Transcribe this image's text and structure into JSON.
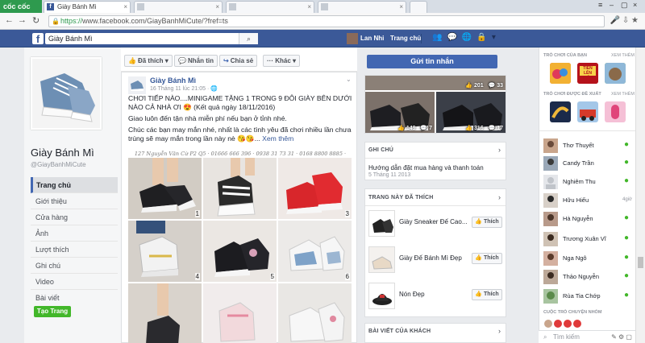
{
  "browser": {
    "brand": "cốc cốc",
    "tabs": [
      {
        "label": "Giày Bánh Mì"
      }
    ],
    "url_prefix": "https://",
    "url_rest": "www.facebook.com/GiayBanhMiCute/?fref=ts"
  },
  "fb": {
    "logo": "f",
    "search_value": "Giày Bánh Mì",
    "user": "Lan Nhi",
    "home": "Trang chủ",
    "brand_color": "#3b5998"
  },
  "page": {
    "name": "Giày Bánh Mì",
    "handle": "@GiayBanhMiCute",
    "nav": [
      "Trang chủ",
      "Giới thiệu",
      "Cửa hàng",
      "Ảnh",
      "Lượt thích",
      "Ghi chú",
      "Video",
      "Bài viết"
    ],
    "create_page": "Tạo Trang"
  },
  "actions": {
    "liked": "Đã thích",
    "message": "Nhắn tin",
    "share": "Chia sẻ",
    "more": "Khác",
    "send_message": "Gửi tin nhắn"
  },
  "post": {
    "author": "Giày Bánh Mì",
    "time": "16 Tháng 11 lúc 21:05 · ",
    "line1": "CHƠI TIẾP NÀO....MINIGAME TẶNG 1 TRONG 9 ĐÔI GIÀY BÊN DƯỚI NÀO CẢ NHÀ ƠI 😍 (Kết quả ngày 18/11/2016)",
    "line2": "Giao luôn đến tận nhà miễn phí nếu bạn ở tỉnh nhé.",
    "line3": "Chúc các bạn may mắn nhé, nhất là các tình yêu đã chơi nhiều lần chưa trúng sẽ may mắn trong lần này nè 😘😘...",
    "see_more": "Xem thêm",
    "banner": "127 Nguyễn Văn Cừ P2 Q5 · 01666 666 396 · 0938 31 73 31 · 0168 8800 8885 · PAOvn",
    "photo_numbers": [
      "1",
      "2",
      "3",
      "4",
      "5",
      "6"
    ]
  },
  "side_photos": [
    {
      "likes": "201",
      "comments": "33"
    },
    {
      "likes": "149",
      "comments": "7"
    },
    {
      "likes": "316",
      "comments": "17"
    }
  ],
  "notes": {
    "title": "GHI CHÚ",
    "item": "Hướng dẫn đặt mua hàng và thanh toán",
    "date": "5 Tháng 11 2013"
  },
  "liked_pages": {
    "title": "TRANG NÀY ĐÃ THÍCH",
    "items": [
      {
        "name": "Giày Sneaker Đế Cao...",
        "btn": "Thích"
      },
      {
        "name": "Giày Đế Bánh Mì Đẹp",
        "btn": "Thích"
      },
      {
        "name": "Nón Đẹp",
        "btn": "Thích"
      }
    ]
  },
  "visitor_posts": {
    "title": "BÀI VIẾT CỦA KHÁCH"
  },
  "chat": {
    "games_title": "TRÒ CHƠI CỦA BẠN",
    "games_more": "XEM THÊM",
    "suggest_title": "TRÒ CHƠI ĐƯỢC ĐỀ XUẤT",
    "suggest_more": "XEM THÊM",
    "game_banner": "TIẾN LÊN MIỀN NAM",
    "friends": [
      {
        "name": "Thơ Thuyết",
        "status": "●",
        "ago": ""
      },
      {
        "name": "Candy Trần",
        "status": "●",
        "ago": ""
      },
      {
        "name": "Nghiêm Thu",
        "status": "●",
        "ago": ""
      },
      {
        "name": "Hữu Hiếu",
        "status": "",
        "ago": "4giờ"
      },
      {
        "name": "Hà Nguyễn",
        "status": "●",
        "ago": ""
      },
      {
        "name": "Trương Xuân Vĩ",
        "status": "●",
        "ago": ""
      },
      {
        "name": "Nga Ngô",
        "status": "●",
        "ago": ""
      },
      {
        "name": "Thảo Nguyễn",
        "status": "●",
        "ago": ""
      },
      {
        "name": "Rùa Tia Chớp",
        "status": "●",
        "ago": ""
      }
    ],
    "groups_title": "CUỘC TRÒ CHUYỆN NHÓM",
    "search_placeholder": "Tìm kiếm"
  }
}
